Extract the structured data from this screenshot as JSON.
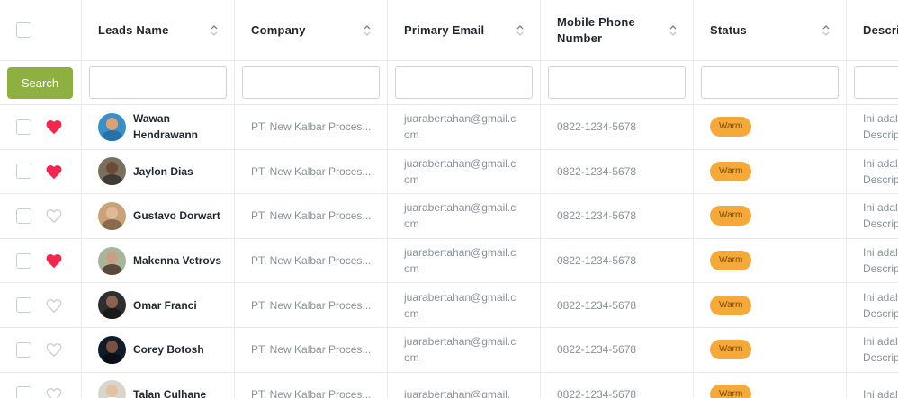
{
  "columns": {
    "leads_name": "Leads Name",
    "company": "Company",
    "primary_email": "Primary Email",
    "mobile_phone": "Mobile Phone Number",
    "status": "Status",
    "description": "Descri"
  },
  "filter": {
    "search_label": "Search"
  },
  "rows": [
    {
      "favorite": true,
      "name": "Wawan Hendrawann",
      "company": "PT. New Kalbar Proces...",
      "email": "juarabertahan@gmail.com",
      "phone": "0822-1234-5678",
      "status": "Warm",
      "desc_line1": "Ini adal",
      "desc_line2": "Descrip",
      "avatar_bg": "#3b8fc9",
      "avatar_skin": "#d9a37a",
      "avatar_body": "#2a6fa8"
    },
    {
      "favorite": true,
      "name": "Jaylon Dias",
      "company": "PT. New Kalbar Proces...",
      "email": "juarabertahan@gmail.com",
      "phone": "0822-1234-5678",
      "status": "Warm",
      "desc_line1": "Ini adal",
      "desc_line2": "Descrip",
      "avatar_bg": "#7a6f5f",
      "avatar_skin": "#6b4a35",
      "avatar_body": "#3f3a33"
    },
    {
      "favorite": false,
      "name": "Gustavo Dorwart",
      "company": "PT. New Kalbar Proces...",
      "email": "juarabertahan@gmail.com",
      "phone": "0822-1234-5678",
      "status": "Warm",
      "desc_line1": "Ini adal",
      "desc_line2": "Descrip",
      "avatar_bg": "#c9a27a",
      "avatar_skin": "#e0b896",
      "avatar_body": "#8a6a4a"
    },
    {
      "favorite": true,
      "name": "Makenna Vetrovs",
      "company": "PT. New Kalbar Proces...",
      "email": "juarabertahan@gmail.com",
      "phone": "0822-1234-5678",
      "status": "Warm",
      "desc_line1": "Ini adal",
      "desc_line2": "Descrip",
      "avatar_bg": "#a7b59a",
      "avatar_skin": "#caa084",
      "avatar_body": "#5a4a3c"
    },
    {
      "favorite": false,
      "name": "Omar Franci",
      "company": "PT. New Kalbar Proces...",
      "email": "juarabertahan@gmail.com",
      "phone": "0822-1234-5678",
      "status": "Warm",
      "desc_line1": "Ini adal",
      "desc_line2": "Descrip",
      "avatar_bg": "#2e2e2e",
      "avatar_skin": "#8a6450",
      "avatar_body": "#1a1a1a"
    },
    {
      "favorite": false,
      "name": "Corey Botosh",
      "company": "PT. New Kalbar Proces...",
      "email": "juarabertahan@gmail.com",
      "phone": "0822-1234-5678",
      "status": "Warm",
      "desc_line1": "Ini adal",
      "desc_line2": "Descrip",
      "avatar_bg": "#111c2a",
      "avatar_skin": "#7a5040",
      "avatar_body": "#0a0f17"
    },
    {
      "favorite": false,
      "name": "Talan Culhane",
      "company": "PT. New Kalbar Proces...",
      "email": "juarabertahan@gmail.",
      "phone": "0822-1234-5678",
      "status": "Warm",
      "desc_line1": "Ini adal",
      "desc_line2": "",
      "avatar_bg": "#d9d4cc",
      "avatar_skin": "#e3c2a0",
      "avatar_body": "#ffffff"
    }
  ],
  "colors": {
    "heart_active": "#f0284f",
    "heart_inactive": "#c9ced4",
    "search_button": "#8db041",
    "status_warm": "#f4a93a"
  }
}
